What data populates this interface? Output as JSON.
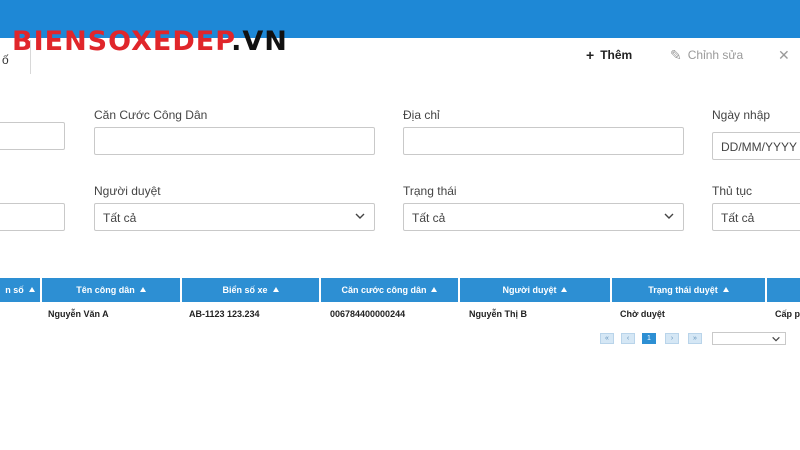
{
  "brand": {
    "part1": "BIENSOXEDEP",
    "part2": ".VN"
  },
  "tab_fragment": "ố",
  "toolbar": {
    "add_label": "Thêm",
    "edit_label": "Chỉnh sửa"
  },
  "form": {
    "cccd_label": "Căn Cước Công Dân",
    "address_label": "Địa chỉ",
    "date_label": "Ngày  nhập",
    "date_value": "DD/MM/YYYY",
    "approver_label": "Người duyệt",
    "approver_value": "Tất cả",
    "status_label": "Trạng thái",
    "status_value": "Tất cả",
    "procedure_label": "Thủ tục",
    "procedure_value": "Tất cả"
  },
  "table": {
    "columns": [
      "n số",
      "Tên công dân",
      "Biển số xe",
      "Căn cước công dân",
      "Người duyệt",
      "Trạng thái duyệt"
    ],
    "row": [
      "Nguyễn Văn A",
      "AB-1123 123.234",
      "006784400000244",
      "Nguyễn Thị B",
      "Chờ duyệt",
      "Cấp p"
    ]
  },
  "pager": {
    "first": "«",
    "prev": "‹",
    "current": "1",
    "next": "›",
    "last": "»"
  },
  "colors": {
    "header_blue": "#1e88d6",
    "grid_blue": "#2d8fd3",
    "brand_red": "#e0262b"
  }
}
